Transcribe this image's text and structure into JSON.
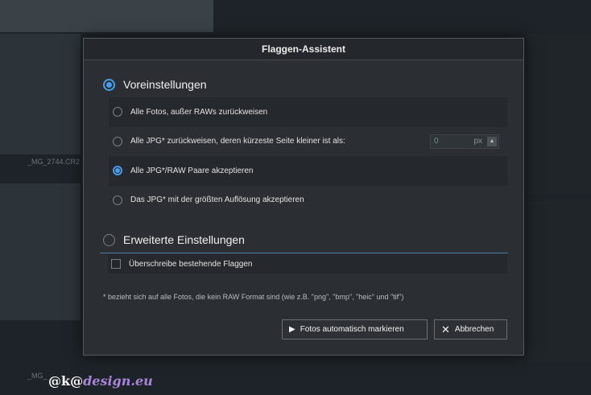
{
  "dialog": {
    "title": "Flaggen-Assistent",
    "presets": {
      "label": "Voreinstellungen",
      "selected": true,
      "options": [
        {
          "label": "Alle Fotos, außer RAWs zurückweisen",
          "selected": false
        },
        {
          "label": "Alle JPG* zurückweisen, deren kürzeste Seite kleiner ist als:",
          "selected": false
        },
        {
          "label": "Alle JPG*/RAW Paare akzeptieren",
          "selected": true
        },
        {
          "label": "Das JPG* mit der größten Auflösung akzeptieren",
          "selected": false
        }
      ],
      "size_field": {
        "value": "0",
        "unit": "px"
      }
    },
    "advanced": {
      "label": "Erweiterte Einstellungen",
      "selected": false,
      "overwrite_label": "Überschreibe bestehende Flaggen",
      "overwrite_checked": false
    },
    "note": "* bezieht sich auf alle Fotos, die kein RAW Format sind (wie z.B. \"png\", \"bmp\", \"heic\" und \"tif\")",
    "buttons": {
      "auto_mark": "Fotos automatisch markieren",
      "cancel": "Abbrechen"
    }
  },
  "background": {
    "file_label_1": "_MG_2744.CR2",
    "file_label_2": "_MG_"
  },
  "watermark": {
    "prefix": "@k@",
    "brand": "design.eu"
  },
  "colors": {
    "accent": "#4a9be8",
    "dialog_bg": "#2b2f33"
  }
}
